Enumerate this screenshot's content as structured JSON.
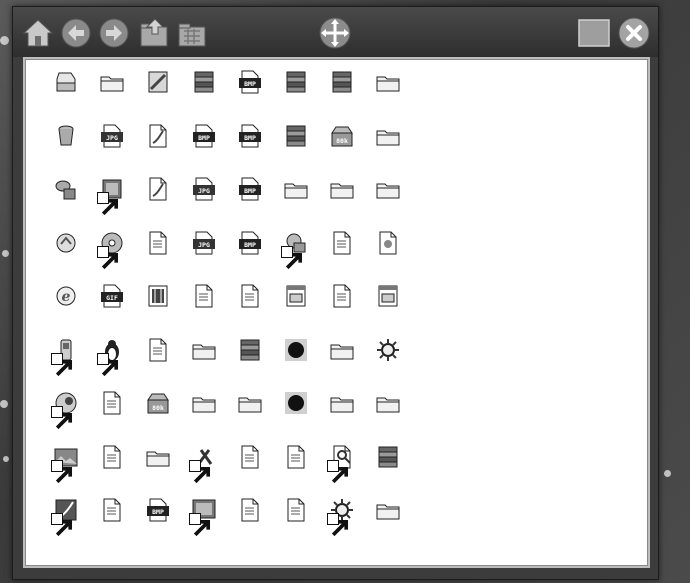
{
  "toolbar": {
    "buttons": [
      {
        "name": "home-icon"
      },
      {
        "name": "back-arrow-icon"
      },
      {
        "name": "forward-arrow-icon"
      },
      {
        "name": "folder-up-icon"
      },
      {
        "name": "folder-grid-icon"
      },
      {
        "name": "move-cross-icon"
      },
      {
        "name": "maximize-icon"
      },
      {
        "name": "close-icon"
      }
    ]
  },
  "file_grid": {
    "columns": 8,
    "rows": [
      [
        {
          "icon": "drive"
        },
        {
          "icon": "folder"
        },
        {
          "icon": "image-doc"
        },
        {
          "icon": "archive"
        },
        {
          "icon": "bmp",
          "label": "BMP"
        },
        {
          "icon": "archive"
        },
        {
          "icon": "archive"
        },
        {
          "icon": "folder"
        }
      ],
      [
        {
          "icon": "trash"
        },
        {
          "icon": "jpg",
          "label": "JPG"
        },
        {
          "icon": "paint-doc"
        },
        {
          "icon": "bmp",
          "label": "BMP"
        },
        {
          "icon": "bmp",
          "label": "BMP"
        },
        {
          "icon": "archive"
        },
        {
          "icon": "box",
          "label": "80k"
        },
        {
          "icon": "folder"
        }
      ],
      [
        {
          "icon": "network"
        },
        {
          "icon": "app",
          "shortcut": true
        },
        {
          "icon": "paint-doc"
        },
        {
          "icon": "jpg",
          "label": "JPG"
        },
        {
          "icon": "bmp",
          "label": "BMP"
        },
        {
          "icon": "folder"
        },
        {
          "icon": "folder"
        },
        {
          "icon": "folder"
        }
      ],
      [
        {
          "icon": "recycle"
        },
        {
          "icon": "disc",
          "shortcut": true
        },
        {
          "icon": "note"
        },
        {
          "icon": "jpg",
          "label": "JPG"
        },
        {
          "icon": "bmp",
          "label": "BMP"
        },
        {
          "icon": "globe-app",
          "shortcut": true
        },
        {
          "icon": "note"
        },
        {
          "icon": "script-doc"
        }
      ],
      [
        {
          "icon": "ie"
        },
        {
          "icon": "gif",
          "label": "GIF"
        },
        {
          "icon": "film"
        },
        {
          "icon": "note"
        },
        {
          "icon": "note"
        },
        {
          "icon": "web-doc"
        },
        {
          "icon": "note"
        },
        {
          "icon": "web-doc"
        }
      ],
      [
        {
          "icon": "phone",
          "shortcut": true
        },
        {
          "icon": "penguin",
          "shortcut": true
        },
        {
          "icon": "note"
        },
        {
          "icon": "folder"
        },
        {
          "icon": "archive"
        },
        {
          "icon": "record"
        },
        {
          "icon": "folder"
        },
        {
          "icon": "gear"
        }
      ],
      [
        {
          "icon": "disc-sun",
          "shortcut": true
        },
        {
          "icon": "note"
        },
        {
          "icon": "box",
          "label": "80k"
        },
        {
          "icon": "folder"
        },
        {
          "icon": "folder"
        },
        {
          "icon": "record"
        },
        {
          "icon": "folder"
        },
        {
          "icon": "folder"
        }
      ],
      [
        {
          "icon": "picture",
          "shortcut": true
        },
        {
          "icon": "note"
        },
        {
          "icon": "folder"
        },
        {
          "icon": "tools",
          "shortcut": true
        },
        {
          "icon": "note"
        },
        {
          "icon": "note"
        },
        {
          "icon": "search-doc",
          "shortcut": true
        },
        {
          "icon": "archive"
        }
      ],
      [
        {
          "icon": "feather",
          "shortcut": true
        },
        {
          "icon": "note"
        },
        {
          "icon": "bmp",
          "label": "BMP"
        },
        {
          "icon": "photo",
          "shortcut": true
        },
        {
          "icon": "note"
        },
        {
          "icon": "note"
        },
        {
          "icon": "gear",
          "shortcut": true
        },
        {
          "icon": "folder"
        }
      ]
    ]
  }
}
